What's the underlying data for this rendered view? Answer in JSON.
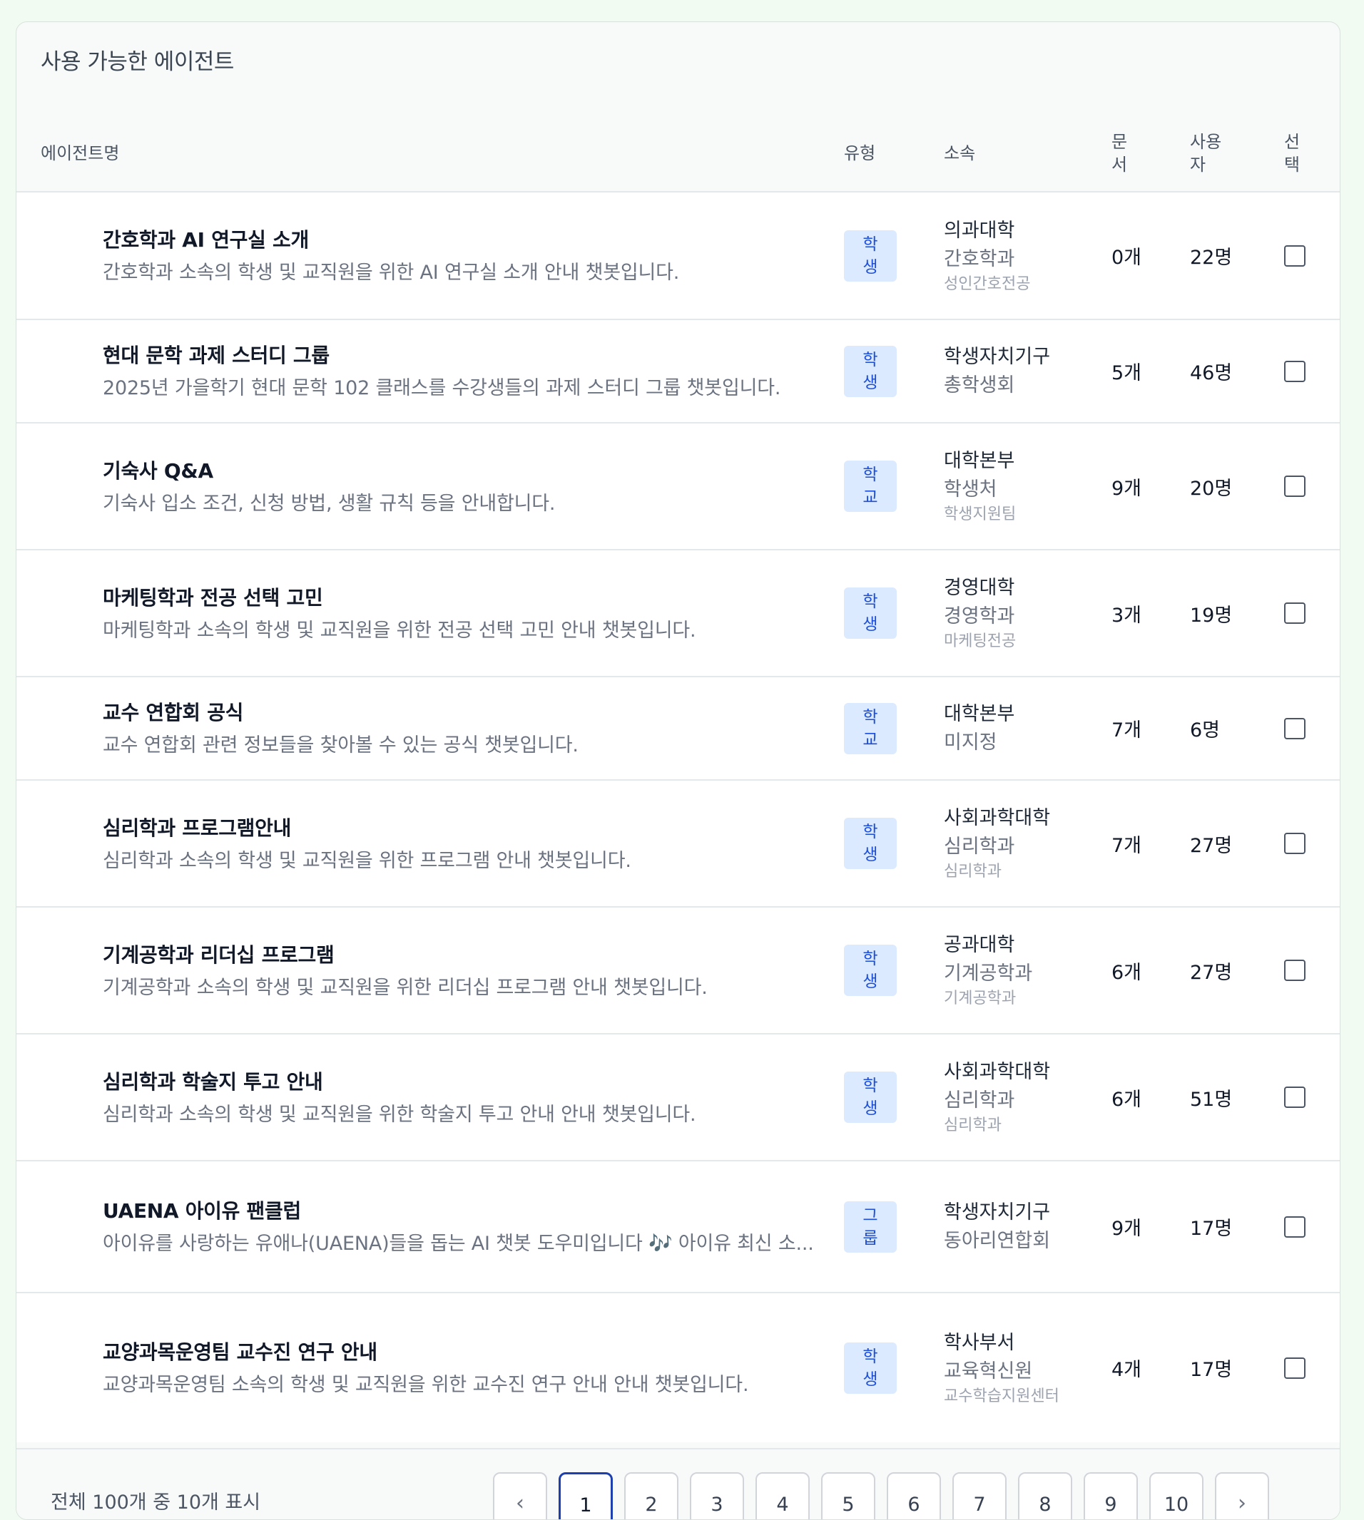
{
  "panel": {
    "title": "사용 가능한 에이전트"
  },
  "table": {
    "headers": {
      "name": "에이전트명",
      "type": "유형",
      "affiliation": "소속",
      "docs": "문서",
      "users": "사용자",
      "select": "선택"
    },
    "rows": [
      {
        "title": "간호학과 AI 연구실 소개",
        "desc": "간호학과 소속의 학생 및 교직원을 위한 AI 연구실 소개 안내 챗봇입니다.",
        "type": "학생",
        "aff1": "의과대학",
        "aff2": "간호학과",
        "aff3": "성인간호전공",
        "docs": "0개",
        "users": "22명"
      },
      {
        "title": "현대 문학 과제 스터디 그룹",
        "desc": "2025년 가을학기 현대 문학 102 클래스를 수강생들의 과제 스터디 그룹 챗봇입니다.",
        "type": "학생",
        "aff1": "학생자치기구",
        "aff2": "총학생회",
        "aff3": "",
        "docs": "5개",
        "users": "46명"
      },
      {
        "title": "기숙사 Q&A",
        "desc": "기숙사 입소 조건, 신청 방법, 생활 규칙 등을 안내합니다.",
        "type": "학교",
        "aff1": "대학본부",
        "aff2": "학생처",
        "aff3": "학생지원팀",
        "docs": "9개",
        "users": "20명"
      },
      {
        "title": "마케팅학과 전공 선택 고민",
        "desc": "마케팅학과 소속의 학생 및 교직원을 위한 전공 선택 고민 안내 챗봇입니다.",
        "type": "학생",
        "aff1": "경영대학",
        "aff2": "경영학과",
        "aff3": "마케팅전공",
        "docs": "3개",
        "users": "19명"
      },
      {
        "title": "교수 연합회 공식",
        "desc": "교수 연합회 관련 정보들을 찾아볼 수 있는 공식 챗봇입니다.",
        "type": "학교",
        "aff1": "대학본부",
        "aff2": "미지정",
        "aff3": "",
        "docs": "7개",
        "users": "6명"
      },
      {
        "title": "심리학과 프로그램안내",
        "desc": "심리학과 소속의 학생 및 교직원을 위한 프로그램 안내 챗봇입니다.",
        "type": "학생",
        "aff1": "사회과학대학",
        "aff2": "심리학과",
        "aff3": "심리학과",
        "docs": "7개",
        "users": "27명"
      },
      {
        "title": "기계공학과 리더십 프로그램",
        "desc": "기계공학과 소속의 학생 및 교직원을 위한 리더십 프로그램 안내 챗봇입니다.",
        "type": "학생",
        "aff1": "공과대학",
        "aff2": "기계공학과",
        "aff3": "기계공학과",
        "docs": "6개",
        "users": "27명"
      },
      {
        "title": "심리학과 학술지 투고 안내",
        "desc": "심리학과 소속의 학생 및 교직원을 위한 학술지 투고 안내 안내 챗봇입니다.",
        "type": "학생",
        "aff1": "사회과학대학",
        "aff2": "심리학과",
        "aff3": "심리학과",
        "docs": "6개",
        "users": "51명"
      },
      {
        "title": "UAENA 아이유 팬클럽",
        "desc": "아이유를 사랑하는 유애나(UAENA)들을 돕는 AI 챗봇 도우미입니다 🎶 아이유 최신 소...",
        "type": "그룹",
        "aff1": "학생자치기구",
        "aff2": "동아리연합회",
        "aff3": "",
        "docs": "9개",
        "users": "17명"
      },
      {
        "title": "교양과목운영팀 교수진 연구 안내",
        "desc": "교양과목운영팀 소속의 학생 및 교직원을 위한 교수진 연구 안내 안내 챗봇입니다.",
        "type": "학생",
        "aff1": "학사부서",
        "aff2": "교육혁신원",
        "aff3": "교수학습지원센터",
        "docs": "4개",
        "users": "17명"
      }
    ]
  },
  "pagination": {
    "summary": "전체 100개 중 10개 표시",
    "prev_icon": "chevron-left-icon",
    "next_icon": "chevron-right-icon",
    "pages": [
      "1",
      "2",
      "3",
      "4",
      "5",
      "6",
      "7",
      "8",
      "9",
      "10"
    ],
    "current": "1"
  }
}
